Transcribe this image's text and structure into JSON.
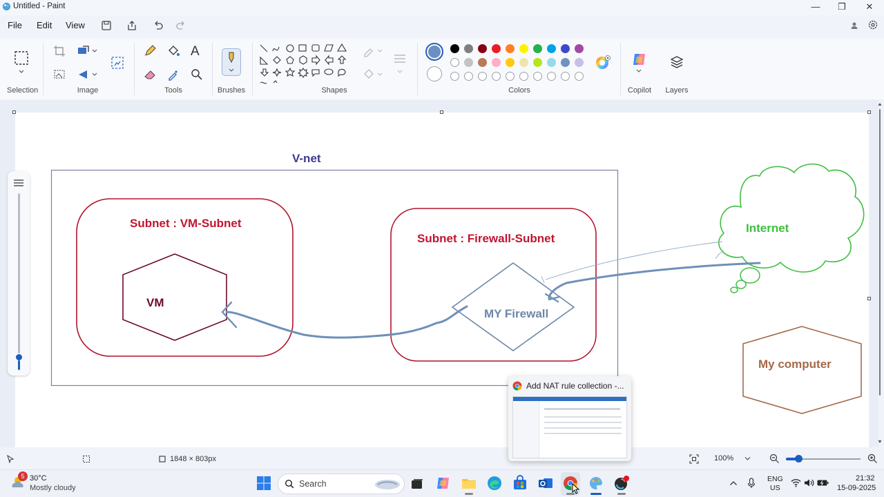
{
  "window": {
    "title": "Untitled - Paint",
    "minimize": "—",
    "restore": "❐",
    "close": "✕"
  },
  "menu": {
    "file": "File",
    "edit": "Edit",
    "view": "View"
  },
  "ribbon": {
    "selection_label": "Selection",
    "image_label": "Image",
    "tools_label": "Tools",
    "brushes_label": "Brushes",
    "shapes_label": "Shapes",
    "colors_label": "Colors",
    "copilot_label": "Copilot",
    "layers_label": "Layers",
    "text_tool": "A"
  },
  "colors": {
    "primary": "#6b8fc2",
    "palette_row1": [
      "#000000",
      "#7f7f7f",
      "#880015",
      "#ed1c24",
      "#ff7f27",
      "#fff200",
      "#22b14c",
      "#00a2e8",
      "#3f48cc",
      "#a349a4"
    ],
    "palette_row2": [
      "#ffffff",
      "#c3c3c3",
      "#b97a57",
      "#ffaec9",
      "#ffc90e",
      "#efe4b0",
      "#b5e61d",
      "#99d9ea",
      "#7092be",
      "#c8bfe7"
    ]
  },
  "diagram": {
    "vnet_label": "V-net",
    "vm_subnet_label": "Subnet : VM-Subnet",
    "vm_label": "VM",
    "fw_subnet_label": "Subnet : Firewall-Subnet",
    "firewall_label": "MY Firewall",
    "internet_label": "Internet",
    "computer_label": "My computer"
  },
  "status": {
    "canvas_size": "1848 × 803px",
    "zoom": "100%"
  },
  "preview": {
    "title": "Add NAT rule collection -..."
  },
  "taskbar": {
    "weather_badge": "5",
    "temperature": "30°C",
    "weather_desc": "Mostly cloudy",
    "search_placeholder": "Search",
    "lang_top": "ENG",
    "lang_bottom": "US",
    "time": "21:32",
    "date": "15-09-2025"
  }
}
